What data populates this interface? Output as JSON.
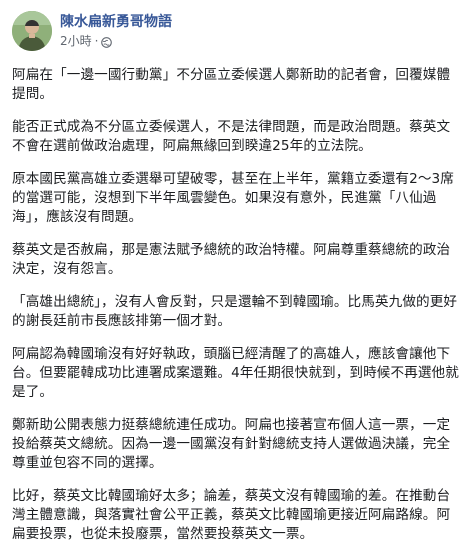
{
  "header": {
    "page_name": "陳水扁新勇哥物語",
    "time": "2小時",
    "separator": "·",
    "audience_icon": "globe-icon",
    "avatar_icon": "profile-photo"
  },
  "post": {
    "paragraphs": [
      "阿扁在「一邊一國行動黨」不分區立委候選人鄭新助的記者會，回覆媒體提問。",
      "能否正式成為不分區立委候選人，不是法律問題，而是政治問題。蔡英文不會在選前做政治處理，阿扁無緣回到睽違25年的立法院。",
      "原本國民黨高雄立委選舉可望破零，甚至在上半年，黨籍立委還有2～3席的當選可能，沒想到下半年風雲變色。如果沒有意外，民進黨「八仙過海」，應該沒有問題。",
      "蔡英文是否赦扁，那是憲法賦予總統的政治特權。阿扁尊重蔡總統的政治決定，沒有怨言。",
      "「高雄出總統」，沒有人會反對，只是還輪不到韓國瑜。比馬英九做的更好的謝長廷前市長應該排第一個才對。",
      "阿扁認為韓國瑜沒有好好執政，頭腦已經清醒了的高雄人，應該會讓他下台。但要罷韓成功比連署成案還難。4年任期很快就到，到時候不再選他就是了。",
      "鄭新助公開表態力挺蔡總統連任成功。阿扁也接著宣布個人這一票，一定投給蔡英文總統。因為一邊一國黨沒有針對總統支持人選做過決議，完全尊重並包容不同的選擇。",
      "比好，蔡英文比韓國瑜好太多；論差，蔡英文沒有韓國瑜的差。在推動台灣主體意識，與落實社會公平正義，蔡英文比韓國瑜更接近阿扁路線。阿扁要投票，也從未投廢票，當然要投蔡英文一票。"
    ]
  },
  "colors": {
    "page_name": "#385898",
    "text": "#1c1e21",
    "meta": "#616770"
  }
}
